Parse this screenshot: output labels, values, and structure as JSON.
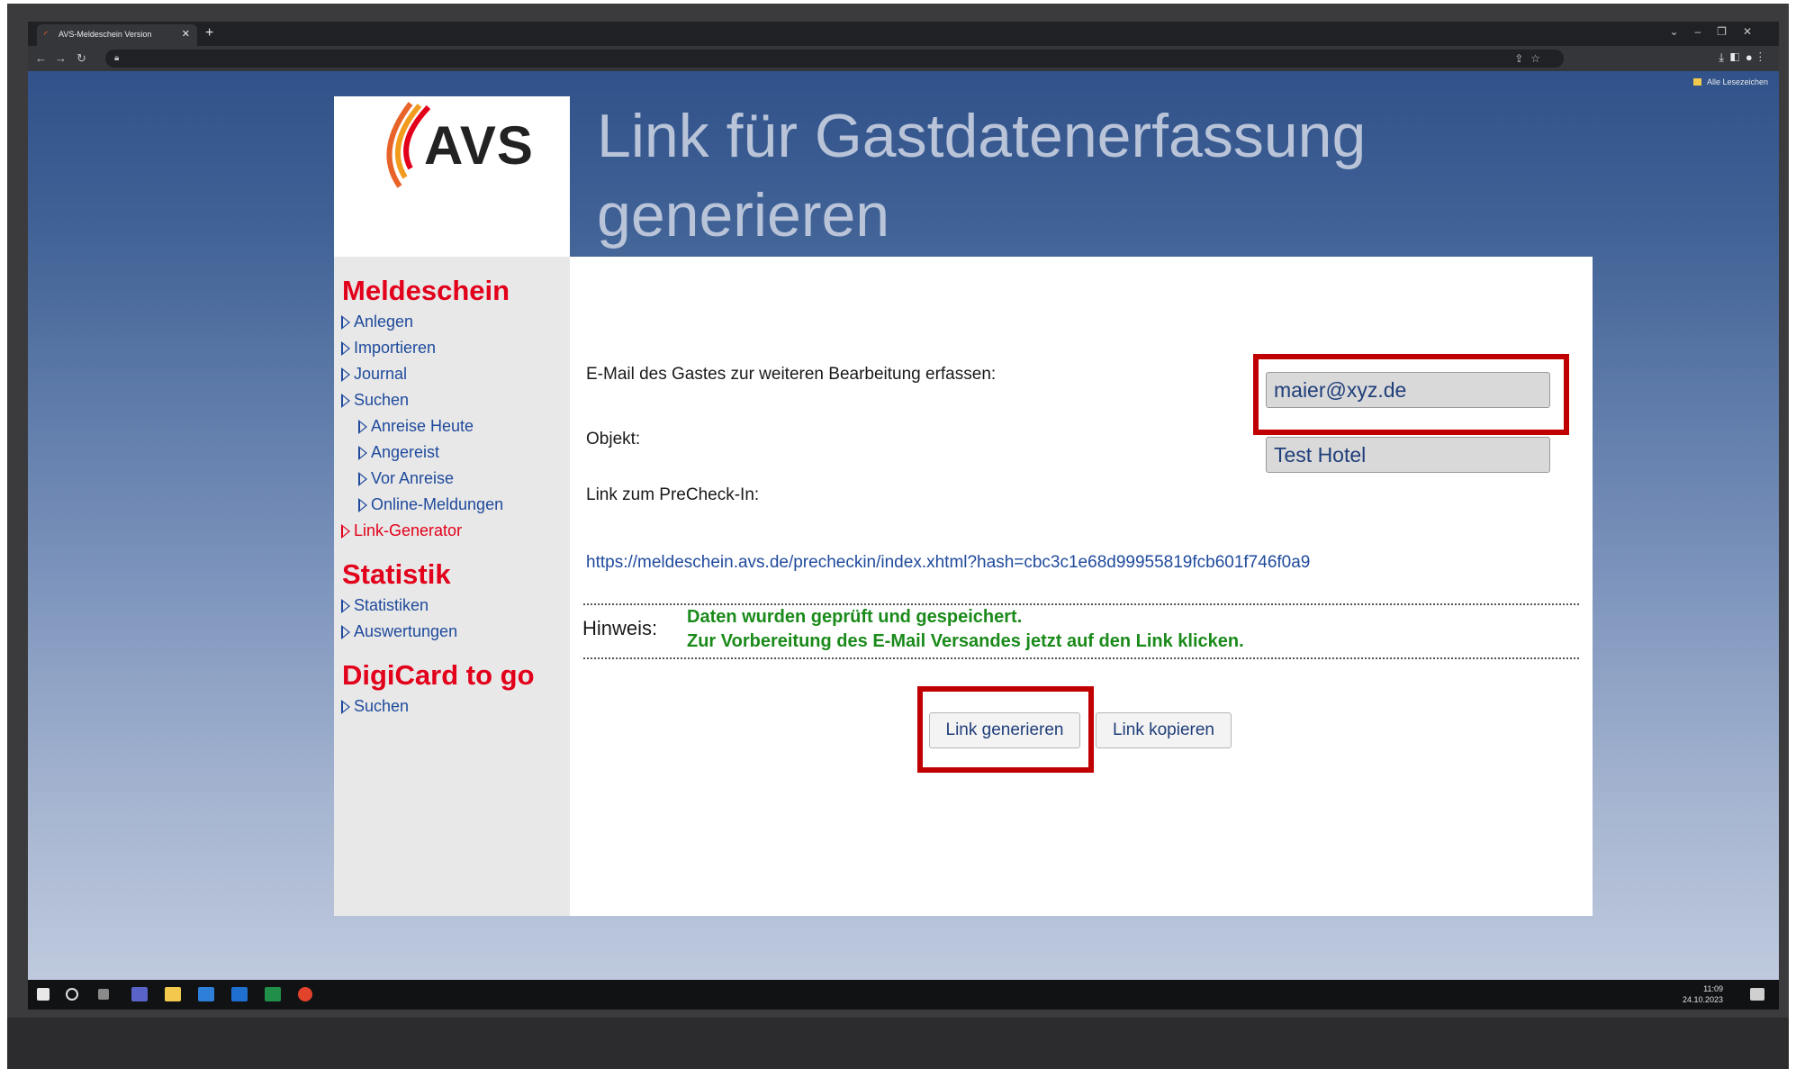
{
  "browser": {
    "tab_title": "AVS-Meldeschein Version",
    "bookmarks_label": "Alle Lesezeichen"
  },
  "logo": {
    "text": "AVS"
  },
  "header": {
    "title_line1": "Link für Gastdatenerfassung",
    "title_line2": "generieren"
  },
  "sidebar": {
    "sections": [
      {
        "title": "Meldeschein"
      },
      {
        "title": "Statistik"
      },
      {
        "title": "DigiCard to go"
      }
    ],
    "items": [
      {
        "label": "Anlegen"
      },
      {
        "label": "Importieren"
      },
      {
        "label": "Journal"
      },
      {
        "label": "Suchen"
      },
      {
        "label": "Anreise Heute"
      },
      {
        "label": "Angereist"
      },
      {
        "label": "Vor Anreise"
      },
      {
        "label": "Online-Meldungen"
      },
      {
        "label": "Link-Generator"
      },
      {
        "label": "Statistiken"
      },
      {
        "label": "Auswertungen"
      },
      {
        "label": "Suchen"
      }
    ]
  },
  "form": {
    "email_label": "E-Mail des Gastes zur weiteren Bearbeitung erfassen:",
    "email_value": "maier@xyz.de",
    "object_label": "Objekt:",
    "object_value": "Test Hotel",
    "link_label": "Link zum PreCheck-In:",
    "link_url": "https://meldeschein.avs.de/precheckin/index.xhtml?hash=cbc3c1e68d99955819fcb601f746f0a9"
  },
  "hint": {
    "label": "Hinweis:",
    "line1": "Daten wurden geprüft und gespeichert.",
    "line2": "Zur Vorbereitung des E-Mail Versandes jetzt auf den Link klicken."
  },
  "buttons": {
    "generate": "Link generieren",
    "copy": "Link kopieren"
  },
  "taskbar": {
    "time": "11:09",
    "date": "24.10.2023"
  },
  "colors": {
    "accent_red": "#e2001a",
    "link_blue": "#1f4a9c",
    "success_green": "#1a8a1a",
    "highlight_red": "#c00000"
  }
}
